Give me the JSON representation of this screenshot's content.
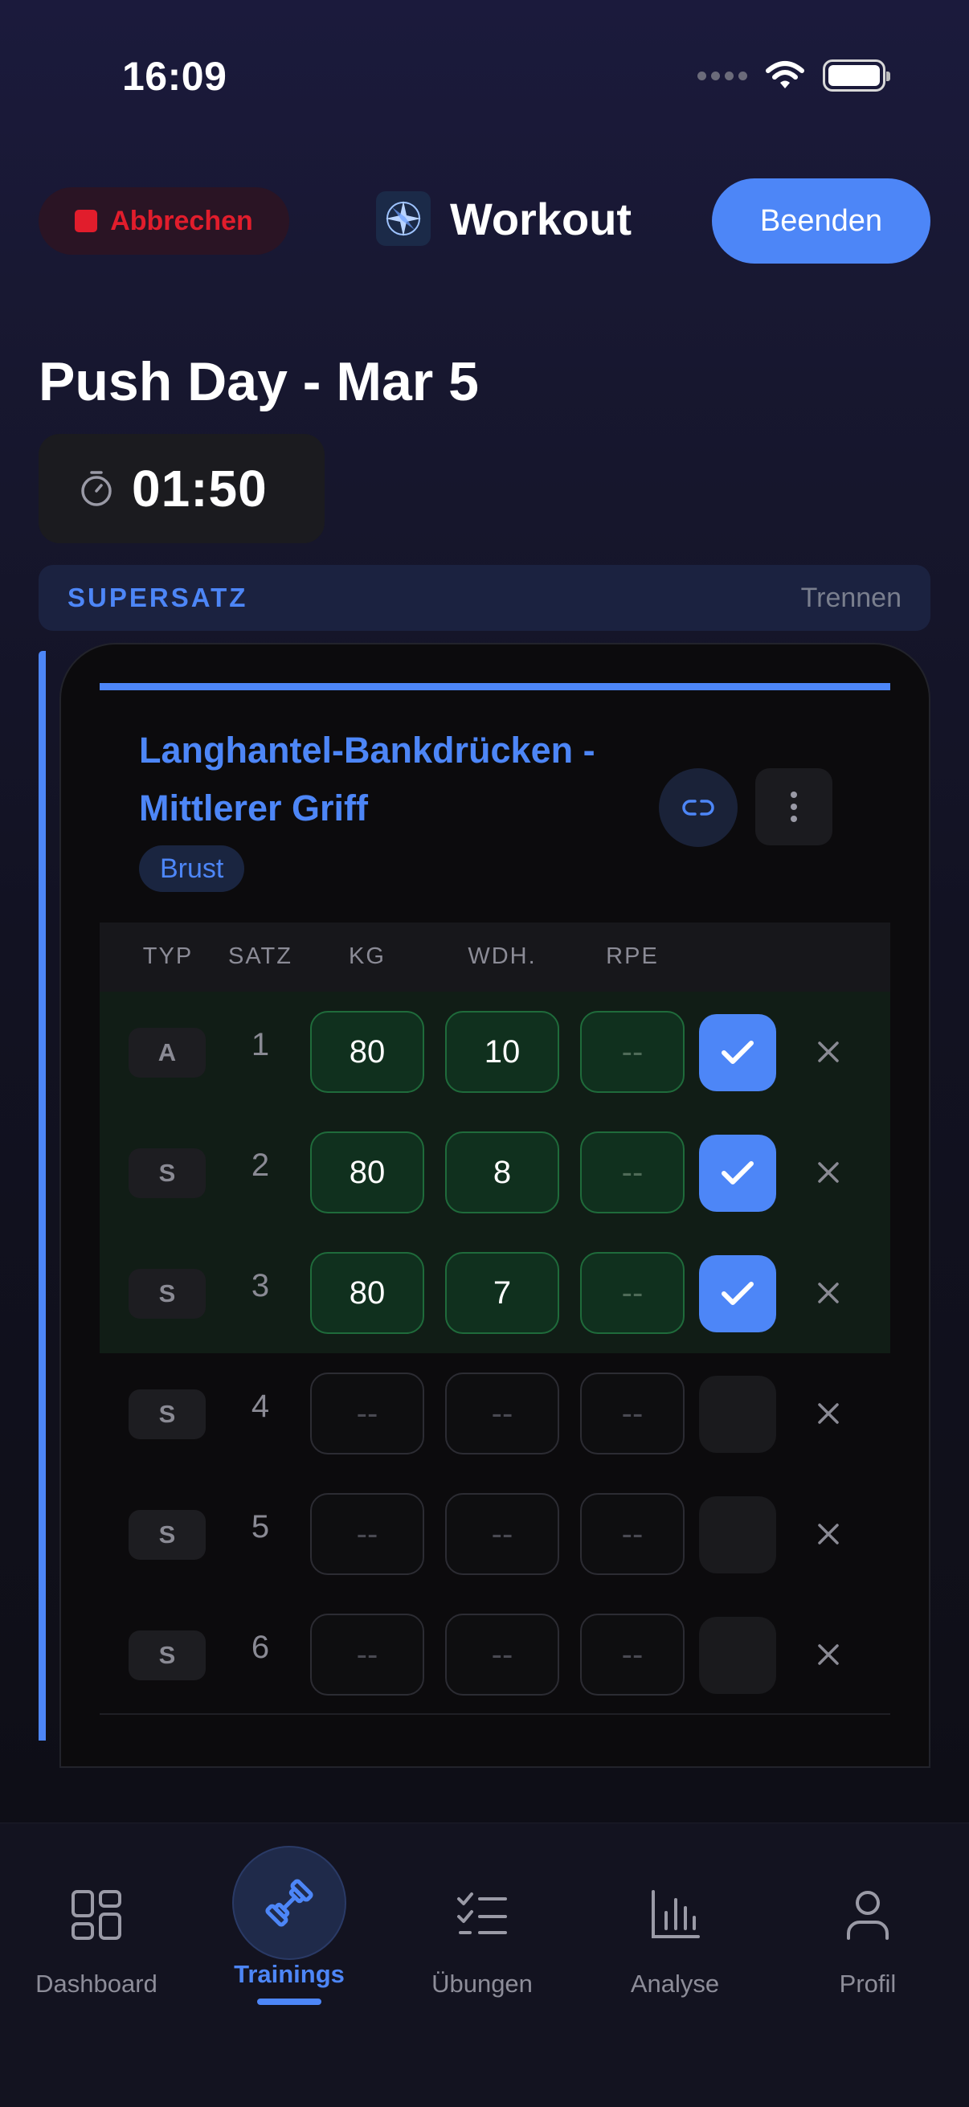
{
  "status_bar": {
    "time": "16:09"
  },
  "header": {
    "cancel_label": "Abbrechen",
    "title": "Workout",
    "finish_label": "Beenden"
  },
  "workout": {
    "name": "Push Day - Mar 5",
    "timer": "01:50"
  },
  "superset": {
    "label": "SUPERSATZ",
    "split_label": "Trennen"
  },
  "exercise": {
    "name": "Langhantel-Bankdrücken - Mittlerer Griff",
    "muscle_tag": "Brust",
    "columns": {
      "type": "TYP",
      "set": "SATZ",
      "kg": "KG",
      "reps": "WDH.",
      "rpe": "RPE"
    },
    "sets": [
      {
        "type": "A",
        "number": "1",
        "kg": "80",
        "reps": "10",
        "rpe": "--",
        "completed": true
      },
      {
        "type": "S",
        "number": "2",
        "kg": "80",
        "reps": "8",
        "rpe": "--",
        "completed": true
      },
      {
        "type": "S",
        "number": "3",
        "kg": "80",
        "reps": "7",
        "rpe": "--",
        "completed": true
      },
      {
        "type": "S",
        "number": "4",
        "kg": "--",
        "reps": "--",
        "rpe": "--",
        "completed": false
      },
      {
        "type": "S",
        "number": "5",
        "kg": "--",
        "reps": "--",
        "rpe": "--",
        "completed": false
      },
      {
        "type": "S",
        "number": "6",
        "kg": "--",
        "reps": "--",
        "rpe": "--",
        "completed": false
      }
    ]
  },
  "tabbar": {
    "items": [
      {
        "label": "Dashboard",
        "icon": "dashboard-grid-icon",
        "active": false
      },
      {
        "label": "Trainings",
        "icon": "dumbbell-icon",
        "active": true
      },
      {
        "label": "Übungen",
        "icon": "checklist-icon",
        "active": false
      },
      {
        "label": "Analyse",
        "icon": "bar-chart-icon",
        "active": false
      },
      {
        "label": "Profil",
        "icon": "person-icon",
        "active": false
      }
    ]
  },
  "colors": {
    "accent": "#4d86f7",
    "danger": "#e11d2c",
    "completed_bg": "#111d16",
    "completed_border": "#1f6b3b"
  }
}
